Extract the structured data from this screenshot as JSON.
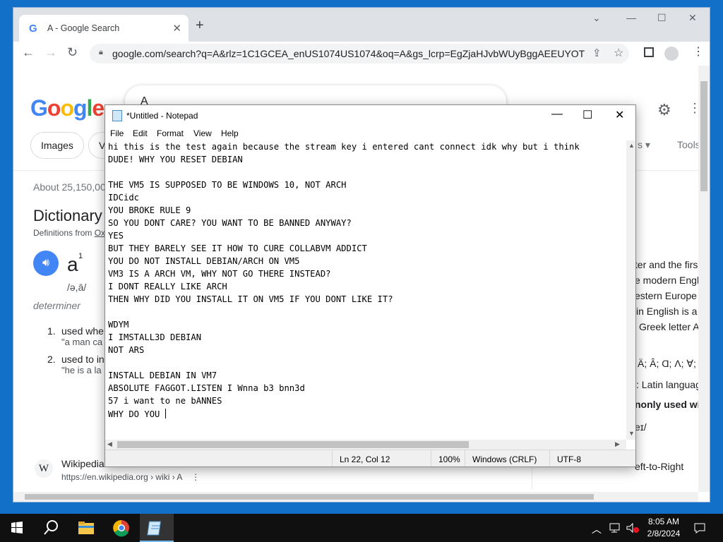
{
  "chrome": {
    "tab_title": "A - Google Search",
    "tab_favicon": "G",
    "url": "google.com/search?q=A&rlz=1C1GCEA_enUS1074US1074&oq=A&gs_lcrp=EgZjaHJvbWUyBggAEEUYOTIT...",
    "icons": [
      "back-icon",
      "forward-icon",
      "reload-icon",
      "lock-icon",
      "share-icon",
      "star-icon",
      "side-panel-icon",
      "profile-icon",
      "menu-icon"
    ]
  },
  "google": {
    "logo": [
      "G",
      "o",
      "o",
      "g",
      "l",
      "e"
    ],
    "logo_colors": [
      "#4285f4",
      "#ea4335",
      "#fbbc05",
      "#4285f4",
      "#34a853",
      "#ea4335"
    ],
    "query": "A",
    "chips": {
      "images": "Images",
      "second": "V"
    },
    "tools": "Tools",
    "right_chip_fragment": "s ▾",
    "results_count": "About 25,150,00",
    "dict_title": "Dictionary",
    "dict_source": "Definitions from ",
    "dict_source_link": "Ox",
    "word": "a",
    "word_sup": "1",
    "phonetic": "/ə,ā/",
    "pos": "determiner",
    "defs": [
      {
        "num": "1.",
        "text": "used whe",
        "example": "\"a man ca"
      },
      {
        "num": "2.",
        "text": "used to in",
        "example": "\"he is a la"
      }
    ],
    "wiki": {
      "icon": "W",
      "name": "Wikipedia",
      "url": "https://en.wikipedia.org › wiki › A",
      "more": "⋮"
    },
    "right_panel": [
      "tter and the firs",
      "e modern Engli",
      "estern Europe",
      "in English is a",
      "Greek letter A",
      "Ä; Â; Ɑ; Λ; ∀;",
      ": Latin languag",
      "nonly used wit",
      "eɪ/",
      "eft-to-Right"
    ]
  },
  "notepad": {
    "title": "*Untitled - Notepad",
    "menu": [
      "File",
      "Edit",
      "Format",
      "View",
      "Help"
    ],
    "lines": [
      "hi this is the test again because the stream key i entered cant connect idk why but i think",
      "DUDE! WHY YOU RESET DEBIAN",
      "",
      "THE VM5 IS SUPPOSED TO BE WINDOWS 10, NOT ARCH",
      "IDCidc",
      "YOU BROKE RULE 9",
      "SO YOU DONT CARE? YOU WANT TO BE BANNED ANYWAY?",
      "YES",
      "BUT THEY BARELY SEE IT HOW TO CURE COLLABVM ADDICT",
      "YOU DO NOT INSTALL DEBIAN/ARCH ON VM5",
      "VM3 IS A ARCH VM, WHY NOT GO THERE INSTEAD?",
      "I DONT REALLY LIKE ARCH",
      "THEN WHY DID YOU INSTALL IT ON VM5 IF YOU DONT LIKE IT?",
      "",
      "WDYM",
      "I IMSTALL3D DEBIAN",
      "NOT ARS",
      "",
      "INSTALL DEBIAN IN VM7",
      "ABSOLUTE FAGGOT.LISTEN I Wnna b3 bnn3d",
      "57 i want to ne bANNES",
      "WHY DO YOU "
    ],
    "status": {
      "position": "Ln 22, Col 12",
      "zoom": "100%",
      "line_ending": "Windows (CRLF)",
      "encoding": "UTF-8"
    }
  },
  "taskbar": {
    "time": "8:05 AM",
    "date": "2/8/2024",
    "items": [
      "start-icon",
      "search-icon",
      "file-explorer-icon",
      "chrome-icon",
      "notepad-icon"
    ],
    "tray": [
      "chevron-up-icon",
      "network-icon",
      "volume-muted-icon",
      "notifications-icon"
    ]
  }
}
